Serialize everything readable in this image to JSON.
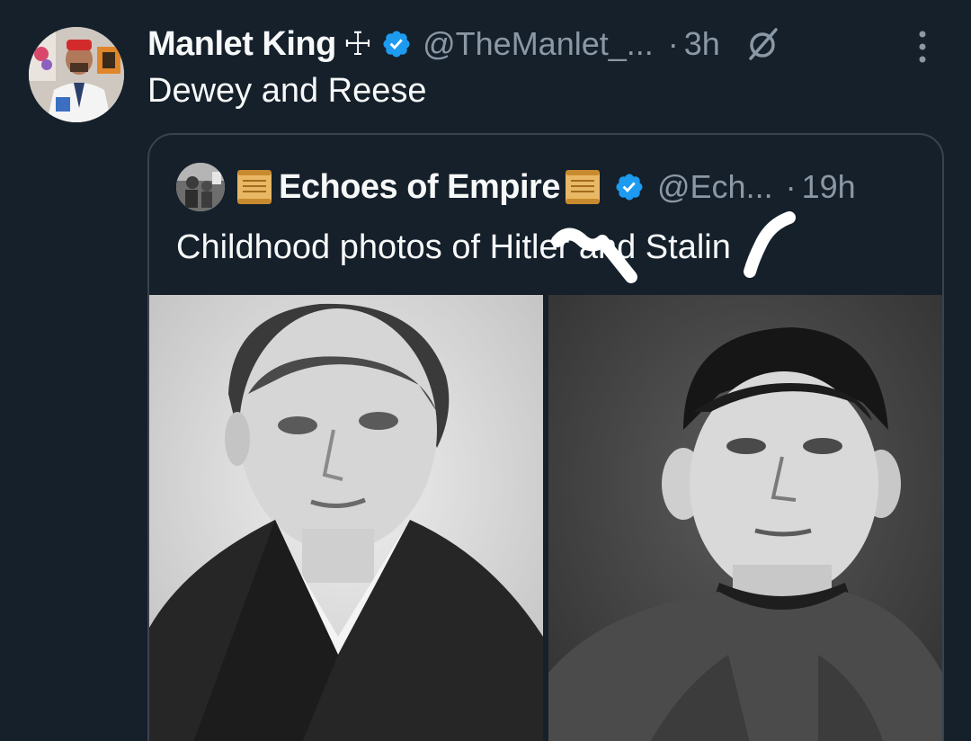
{
  "tweet": {
    "author": {
      "display_name": "Manlet King",
      "name_symbol": "☩",
      "handle": "@TheManlet_...",
      "verified": true
    },
    "time_separator": "·",
    "time": "3h",
    "text": "Dewey and Reese",
    "icons": [
      "cross-symbol-icon",
      "verified-badge-icon",
      "grok-icon",
      "more-options-icon"
    ]
  },
  "quote": {
    "author": {
      "display_name": "Echoes of Empire",
      "handle": "@Ech...",
      "verified": true
    },
    "time_separator": "·",
    "time": "19h",
    "text_part1": "Childhood photos of H",
    "text_censored1": "itl",
    "text_part2": "er and St",
    "text_censored2": "a",
    "text_part3": "lin",
    "icons": [
      "scroll-icon",
      "verified-badge-icon"
    ],
    "photos": [
      "left-photo",
      "right-photo"
    ]
  },
  "colors": {
    "background": "#15202b",
    "text_primary": "#f7f9f9",
    "text_secondary": "#8b98a5",
    "border": "#38444d",
    "verified_blue": "#1d9bf0"
  }
}
